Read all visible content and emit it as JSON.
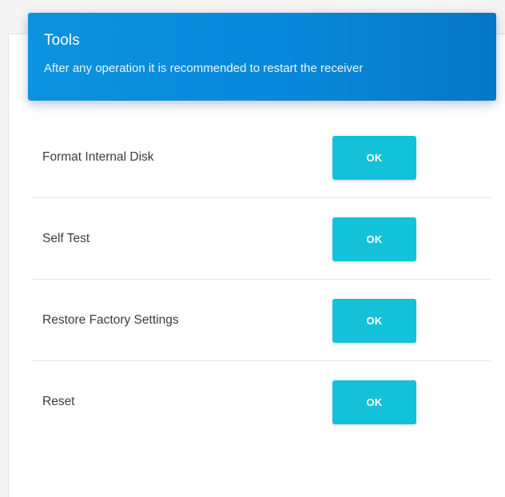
{
  "header": {
    "title": "Tools",
    "subtitle": "After any operation it is recommended to restart the receiver"
  },
  "tools": [
    {
      "label": "Format Internal Disk",
      "button_label": "OK"
    },
    {
      "label": "Self Test",
      "button_label": "OK"
    },
    {
      "label": "Restore Factory Settings",
      "button_label": "OK"
    },
    {
      "label": "Reset",
      "button_label": "OK"
    }
  ],
  "colors": {
    "header_blue": "#0888db",
    "button_cyan": "#13c2d8",
    "divider": "#e3e3e3"
  }
}
